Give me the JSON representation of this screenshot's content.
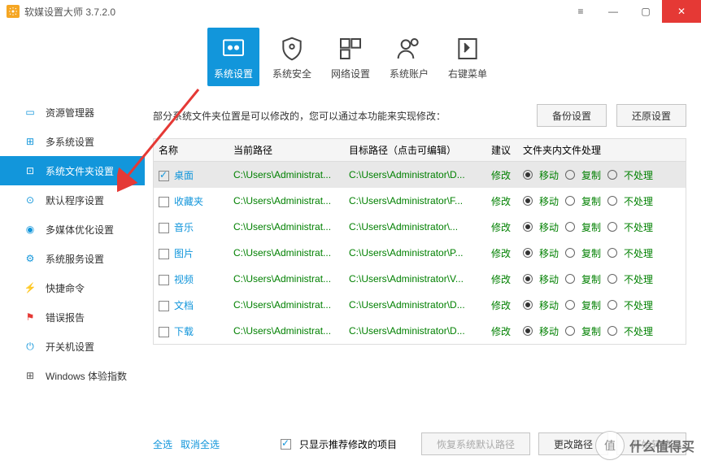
{
  "window": {
    "title": "软媒设置大师 3.7.2.0"
  },
  "topnav": [
    {
      "label": "系统设置",
      "active": true
    },
    {
      "label": "系统安全"
    },
    {
      "label": "网络设置"
    },
    {
      "label": "系统账户"
    },
    {
      "label": "右键菜单"
    }
  ],
  "sidebar": [
    {
      "label": "资源管理器"
    },
    {
      "label": "多系统设置"
    },
    {
      "label": "系统文件夹设置",
      "active": true
    },
    {
      "label": "默认程序设置"
    },
    {
      "label": "多媒体优化设置"
    },
    {
      "label": "系统服务设置"
    },
    {
      "label": "快捷命令"
    },
    {
      "label": "错误报告"
    },
    {
      "label": "开关机设置"
    },
    {
      "label": "Windows 体验指数"
    }
  ],
  "desc": "部分系统文件夹位置是可以修改的，您可以通过本功能来实现修改：",
  "buttons": {
    "backup": "备份设置",
    "restore": "还原设置",
    "recover": "恢复系统默认路径",
    "change": "更改路径",
    "start": "开始转移"
  },
  "headers": {
    "name": "名称",
    "cur": "当前路径",
    "tgt": "目标路径（点击可编辑）",
    "sug": "建议",
    "act": "文件夹内文件处理"
  },
  "radioLabels": {
    "move": "移动",
    "copy": "复制",
    "none": "不处理"
  },
  "rows": [
    {
      "checked": true,
      "name": "桌面",
      "cur": "C:\\Users\\Administrat...",
      "tgt": "C:\\Users\\Administrator\\D...",
      "sug": "修改"
    },
    {
      "checked": false,
      "name": "收藏夹",
      "cur": "C:\\Users\\Administrat...",
      "tgt": "C:\\Users\\Administrator\\F...",
      "sug": "修改"
    },
    {
      "checked": false,
      "name": "音乐",
      "cur": "C:\\Users\\Administrat...",
      "tgt": "C:\\Users\\Administrator\\...",
      "sug": "修改"
    },
    {
      "checked": false,
      "name": "图片",
      "cur": "C:\\Users\\Administrat...",
      "tgt": "C:\\Users\\Administrator\\P...",
      "sug": "修改"
    },
    {
      "checked": false,
      "name": "视频",
      "cur": "C:\\Users\\Administrat...",
      "tgt": "C:\\Users\\Administrator\\V...",
      "sug": "修改"
    },
    {
      "checked": false,
      "name": "文档",
      "cur": "C:\\Users\\Administrat...",
      "tgt": "C:\\Users\\Administrator\\D...",
      "sug": "修改"
    },
    {
      "checked": false,
      "name": "下载",
      "cur": "C:\\Users\\Administrat...",
      "tgt": "C:\\Users\\Administrator\\D...",
      "sug": "修改"
    }
  ],
  "footer": {
    "selectAll": "全选",
    "deselectAll": "取消全选",
    "onlyRecommended": "只显示推荐修改的项目"
  },
  "watermark": {
    "circle": "值",
    "text": "什么值得买"
  }
}
